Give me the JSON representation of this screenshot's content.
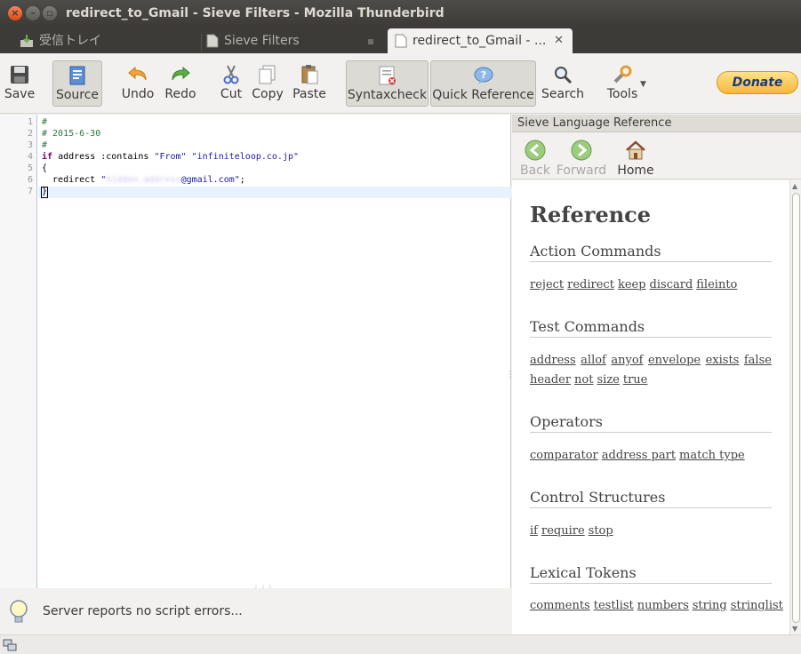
{
  "window": {
    "title": "redirect_to_Gmail - Sieve Filters - Mozilla Thunderbird"
  },
  "tabs": [
    {
      "label": "受信トレイ"
    },
    {
      "label": "Sieve Filters"
    },
    {
      "label": "redirect_to_Gmail - ..."
    }
  ],
  "toolbar": {
    "save": "Save",
    "source": "Source",
    "undo": "Undo",
    "redo": "Redo",
    "cut": "Cut",
    "copy": "Copy",
    "paste": "Paste",
    "syntaxcheck": "Syntaxcheck",
    "quick_reference": "Quick Reference",
    "search": "Search",
    "tools": "Tools",
    "donate": "Donate"
  },
  "editor": {
    "line_numbers": [
      "1",
      "2",
      "3",
      "4",
      "5",
      "6",
      "7"
    ],
    "lines": {
      "l1": "#",
      "l2": "# 2015-6-30",
      "l3": "#",
      "l4_kw": "if",
      "l4_mid": " address :contains ",
      "l4_s1": "\"From\"",
      "l4_s2": "\"infiniteloop.co.jp\"",
      "l5": "{",
      "l6_pre": "  redirect ",
      "l6_q": "\"",
      "l6_blur": "hidden.address",
      "l6_s": "@gmail.com\"",
      "l6_end": ";",
      "l7": "}"
    }
  },
  "status": {
    "message": "Server reports no script errors..."
  },
  "side": {
    "header": "Sieve Language Reference",
    "nav": {
      "back": "Back",
      "forward": "Forward",
      "home": "Home"
    },
    "title": "Reference",
    "sections": {
      "action": {
        "title": "Action Commands",
        "links": [
          "reject",
          "redirect",
          "keep",
          "discard",
          "fileinto"
        ]
      },
      "test": {
        "title": "Test Commands",
        "links": [
          "address",
          "allof",
          "anyof",
          "envelope",
          "exists",
          "false",
          "header",
          "not",
          "size",
          "true"
        ]
      },
      "operators": {
        "title": "Operators",
        "links": [
          "comparator",
          "address part",
          "match type"
        ]
      },
      "control": {
        "title": "Control Structures",
        "links": [
          "if",
          "require",
          "stop"
        ]
      },
      "lexical": {
        "title": "Lexical Tokens",
        "links": [
          "comments",
          "testlist",
          "numbers",
          "string",
          "stringlist"
        ]
      }
    }
  }
}
